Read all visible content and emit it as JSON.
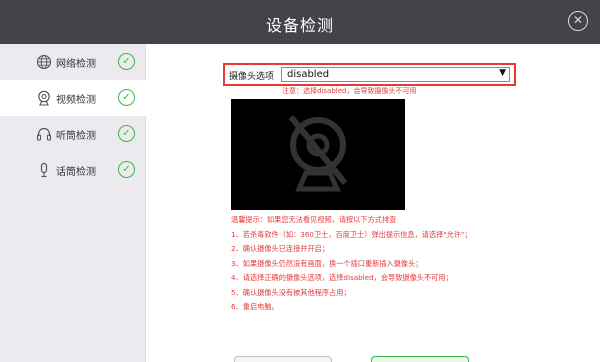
{
  "window": {
    "title": "设备检测",
    "close_icon": "close-circle-icon"
  },
  "sidebar": {
    "items": [
      {
        "label": "网络检测",
        "icon": "globe-icon",
        "status": "check-icon",
        "active": false
      },
      {
        "label": "视频检测",
        "icon": "webcam-icon",
        "status": "check-icon",
        "active": true
      },
      {
        "label": "听筒检测",
        "icon": "headphones-icon",
        "status": "check-icon",
        "active": false
      },
      {
        "label": "话筒检测",
        "icon": "microphone-icon",
        "status": "check-icon",
        "active": false
      }
    ],
    "check_glyph": "✓"
  },
  "camera_select": {
    "label": "摄像头选项",
    "value": "disabled",
    "arrow": "▼"
  },
  "notice": "注意：选择disabled，会导致摄像头不可用",
  "video_preview": {
    "icon": "camera-disabled-icon"
  },
  "tips": {
    "heading": "温馨提示：如果您无法看见视频，请按以下方式排查",
    "steps": [
      "1、若杀毒软件（如：360卫士，百度卫士）弹出提示信息，请选择\"允许\"；",
      "2、确认摄像头已连接并开启；",
      "3、如果摄像头仍然没有画面，换一个插口重新插入摄像头；",
      "4、请选择正确的摄像头选项，选择disabled，会导致摄像头不可用；",
      "5、确认摄像头没有被其他程序占用；",
      "6、重启电脑。"
    ]
  },
  "colors": {
    "titlebar": "#44434a",
    "accent_green": "#3cb54a",
    "alert_red": "#e33b3b",
    "sidebar_bg": "#eceaef"
  }
}
